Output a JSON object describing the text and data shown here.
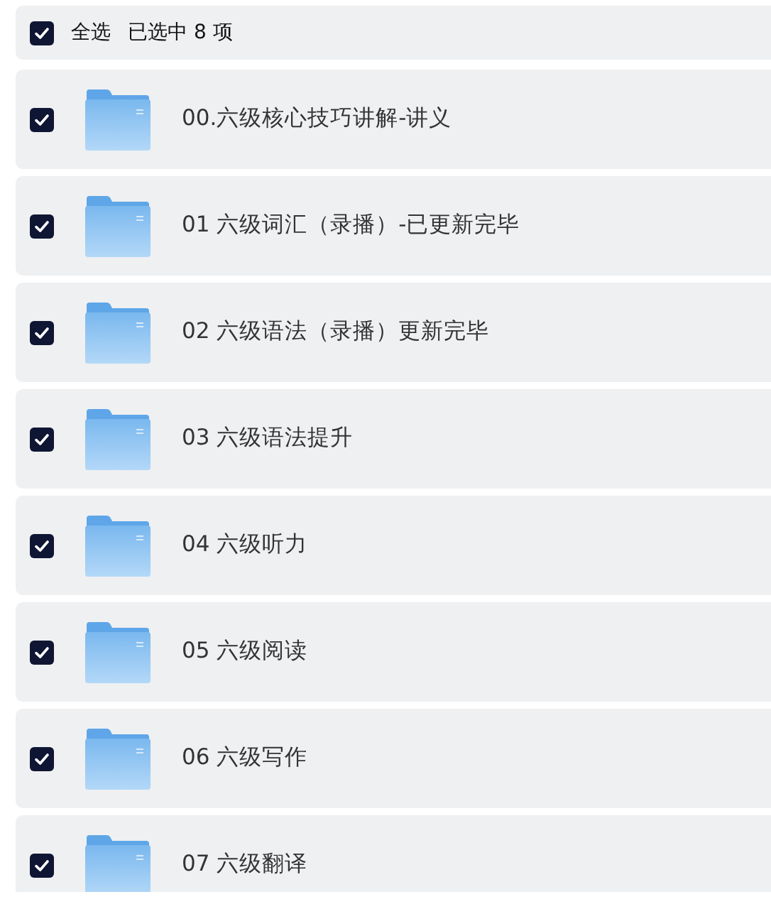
{
  "header": {
    "checked": true,
    "select_all_label": "全选",
    "selection_summary": "已选中 8 项"
  },
  "items": [
    {
      "name": "00.六级核心技巧讲解-讲义",
      "checked": true
    },
    {
      "name": "01 六级词汇（录播）-已更新完毕",
      "checked": true
    },
    {
      "name": "02 六级语法（录播）更新完毕",
      "checked": true
    },
    {
      "name": "03 六级语法提升",
      "checked": true
    },
    {
      "name": "04 六级听力",
      "checked": true
    },
    {
      "name": "05 六级阅读",
      "checked": true
    },
    {
      "name": "06 六级写作",
      "checked": true
    },
    {
      "name": "07 六级翻译",
      "checked": true
    }
  ]
}
